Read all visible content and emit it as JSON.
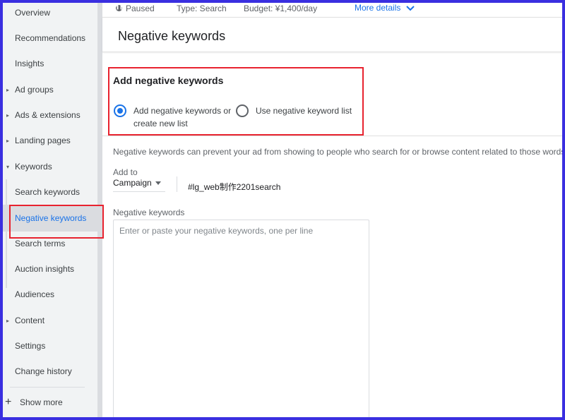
{
  "sidebar": {
    "items": [
      {
        "label": "Overview"
      },
      {
        "label": "Recommendations"
      },
      {
        "label": "Insights"
      },
      {
        "label": "Ad groups"
      },
      {
        "label": "Ads & extensions"
      },
      {
        "label": "Landing pages"
      },
      {
        "label": "Keywords"
      },
      {
        "label": "Search keywords"
      },
      {
        "label": "Negative keywords"
      },
      {
        "label": "Search terms"
      },
      {
        "label": "Auction insights"
      },
      {
        "label": "Audiences"
      },
      {
        "label": "Content"
      },
      {
        "label": "Settings"
      },
      {
        "label": "Change history"
      }
    ],
    "show_more": "Show more"
  },
  "topbar": {
    "status": "Paused",
    "type": "Type: Search",
    "budget": "Budget: ¥1,400/day",
    "more_details": "More details"
  },
  "page": {
    "title": "Negative keywords"
  },
  "add_section": {
    "title": "Add negative keywords",
    "option_new_line1": "Add negative keywords or",
    "option_new_line2": "create new list",
    "option_list": "Use negative keyword list",
    "selected": "new"
  },
  "info_text": "Negative keywords can prevent your ad from showing to people who search for or browse content related to those words",
  "add_to": {
    "label": "Add to",
    "selected": "Campaign",
    "campaign_name": "#lg_web制作2201search"
  },
  "negative_keywords": {
    "label": "Negative keywords",
    "placeholder": "Enter or paste your negative keywords, one per line",
    "value": ""
  },
  "colors": {
    "accent": "#1a73e8",
    "highlight": "#e8232f",
    "frame": "#3a2fe0"
  }
}
